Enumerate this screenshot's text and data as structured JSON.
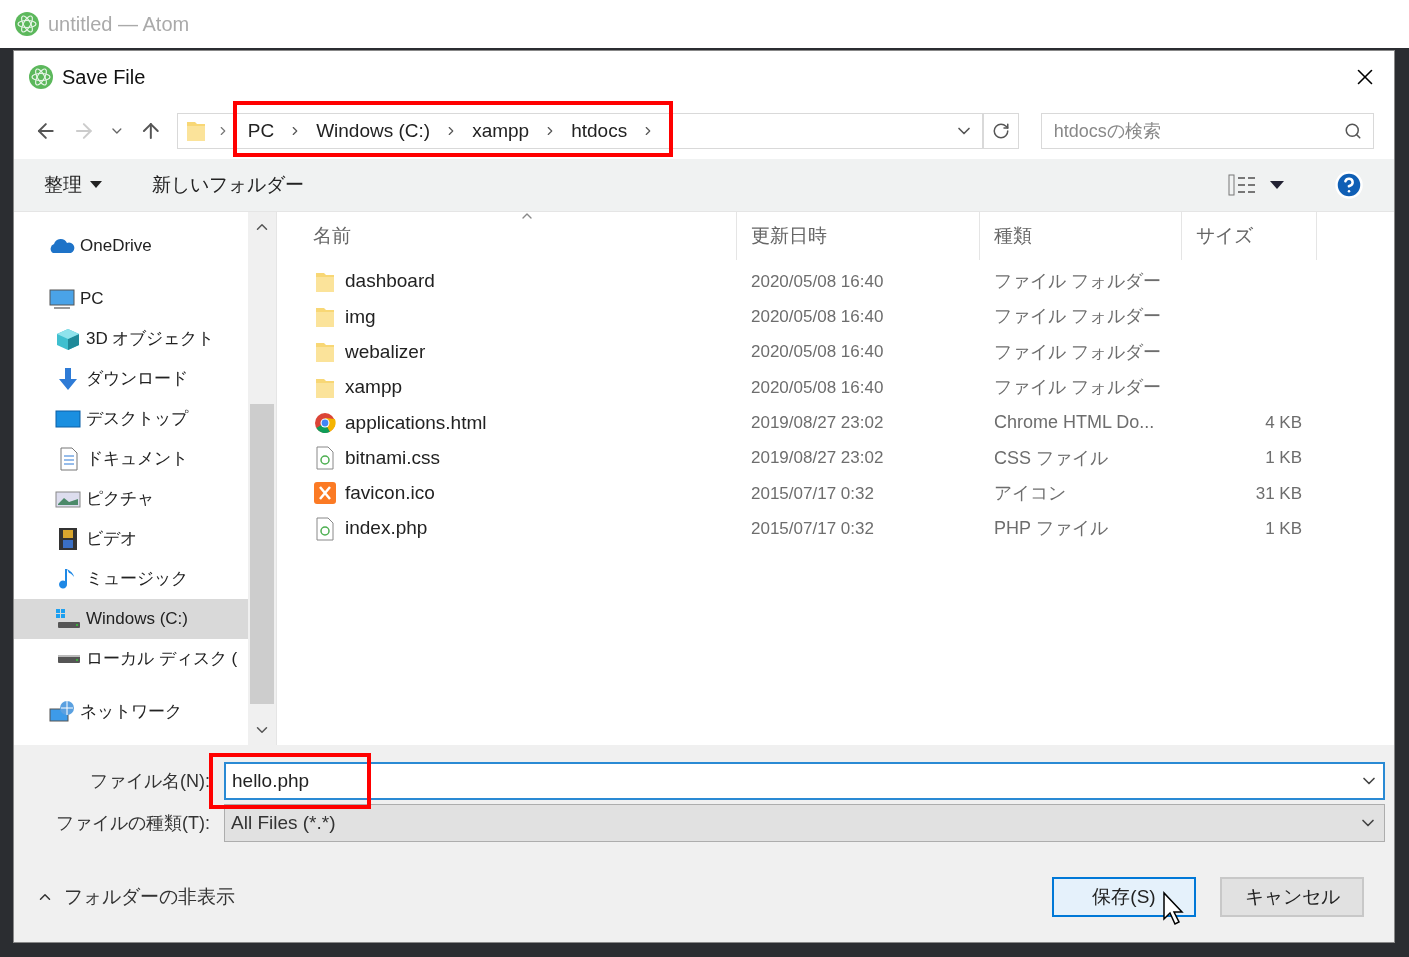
{
  "app_title": "untitled — Atom",
  "dialog": {
    "title": "Save File"
  },
  "path": {
    "highlighted": true,
    "segments": [
      "PC",
      "Windows (C:)",
      "xampp",
      "htdocs"
    ]
  },
  "search": {
    "placeholder": "htdocsの検索"
  },
  "toolbar": {
    "organize": "整理",
    "new_folder": "新しいフォルダー"
  },
  "sidebar": {
    "items": [
      {
        "label": "OneDrive",
        "kind": "cloud",
        "selected": false
      },
      {
        "label": "PC",
        "kind": "pc",
        "selected": false,
        "children": [
          {
            "label": "3D オブジェクト",
            "kind": "cube",
            "selected": false
          },
          {
            "label": "ダウンロード",
            "kind": "download",
            "selected": false
          },
          {
            "label": "デスクトップ",
            "kind": "desktop",
            "selected": false
          },
          {
            "label": "ドキュメント",
            "kind": "document",
            "selected": false
          },
          {
            "label": "ピクチャ",
            "kind": "pictures",
            "selected": false
          },
          {
            "label": "ビデオ",
            "kind": "video",
            "selected": false
          },
          {
            "label": "ミュージック",
            "kind": "music",
            "selected": false
          },
          {
            "label": "Windows (C:)",
            "kind": "windrive",
            "selected": true
          },
          {
            "label": "ローカル ディスク (",
            "kind": "drive",
            "selected": false
          }
        ]
      },
      {
        "label": "ネットワーク",
        "kind": "network",
        "selected": false
      }
    ]
  },
  "table": {
    "columns": [
      "名前",
      "更新日時",
      "種類",
      "サイズ"
    ],
    "rows": [
      {
        "name": "dashboard",
        "kind": "folder",
        "modified": "2020/05/08 16:40",
        "type": "ファイル フォルダー"
      },
      {
        "name": "img",
        "kind": "folder",
        "modified": "2020/05/08 16:40",
        "type": "ファイル フォルダー"
      },
      {
        "name": "webalizer",
        "kind": "folder",
        "modified": "2020/05/08 16:40",
        "type": "ファイル フォルダー"
      },
      {
        "name": "xampp",
        "kind": "folder",
        "modified": "2020/05/08 16:40",
        "type": "ファイル フォルダー"
      },
      {
        "name": "applications.html",
        "kind": "chrome",
        "modified": "2019/08/27 23:02",
        "type": "Chrome HTML Do...",
        "size": "4 KB"
      },
      {
        "name": "bitnami.css",
        "kind": "script",
        "modified": "2019/08/27 23:02",
        "type": "CSS ファイル",
        "size": "1 KB"
      },
      {
        "name": "favicon.ico",
        "kind": "xampp",
        "modified": "2015/07/17 0:32",
        "type": "アイコン",
        "size": "31 KB"
      },
      {
        "name": "index.php",
        "kind": "script",
        "modified": "2015/07/17 0:32",
        "type": "PHP ファイル",
        "size": "1 KB"
      }
    ]
  },
  "filename": {
    "label": "ファイル名(N):",
    "value": "hello.php",
    "highlighted": true
  },
  "filetype": {
    "label": "ファイルの種類(T):",
    "value": "All Files (*.*)"
  },
  "hide_folders": "フォルダーの非表示",
  "buttons": [
    {
      "label": "保存(S)",
      "kind": "primary"
    },
    {
      "label": "キャンセル",
      "kind": "secondary"
    }
  ]
}
